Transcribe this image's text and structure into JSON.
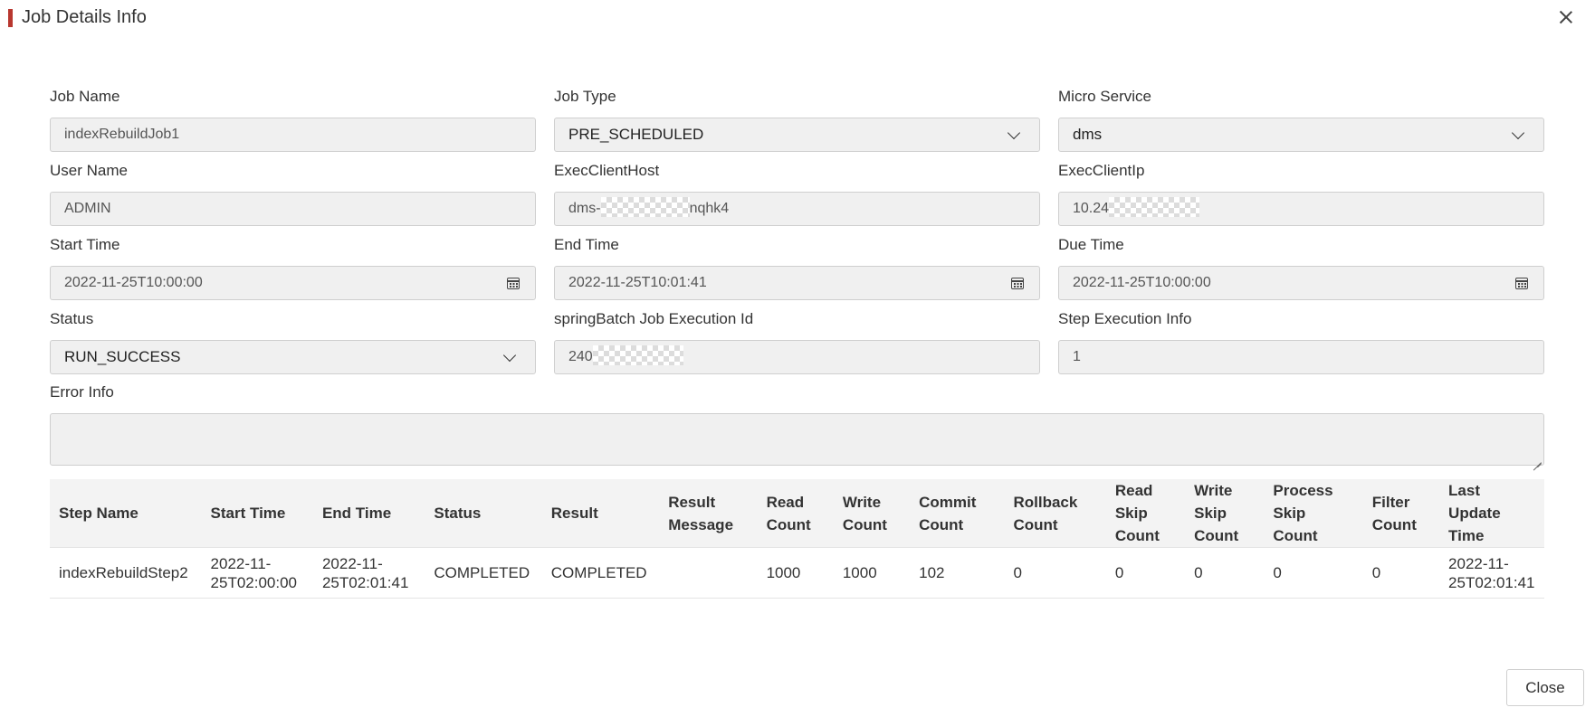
{
  "dialog": {
    "title": "Job Details Info",
    "close_label": "Close"
  },
  "form": {
    "job_name": {
      "label": "Job Name",
      "value": "indexRebuildJob1"
    },
    "job_type": {
      "label": "Job Type",
      "value": "PRE_SCHEDULED"
    },
    "micro_service": {
      "label": "Micro Service",
      "value": "dms"
    },
    "user_name": {
      "label": "User Name",
      "value": "ADMIN"
    },
    "exec_client_host": {
      "label": "ExecClientHost",
      "value_prefix": "dms-",
      "value_suffix": "nqhk4"
    },
    "exec_client_ip": {
      "label": "ExecClientIp",
      "value_prefix": "10.24"
    },
    "start_time": {
      "label": "Start Time",
      "value": "2022-11-25T10:00:00"
    },
    "end_time": {
      "label": "End Time",
      "value": "2022-11-25T10:01:41"
    },
    "due_time": {
      "label": "Due Time",
      "value": "2022-11-25T10:00:00"
    },
    "status": {
      "label": "Status",
      "value": "RUN_SUCCESS"
    },
    "spring_batch_id": {
      "label": "springBatch Job Execution Id",
      "value_prefix": "240"
    },
    "step_execution_info": {
      "label": "Step Execution Info",
      "value": "1"
    },
    "error_info": {
      "label": "Error Info",
      "value": ""
    }
  },
  "table": {
    "headers": [
      "Step Name",
      "Start Time",
      "End Time",
      "Status",
      "Result",
      "Result Message",
      "Read Count",
      "Write Count",
      "Commit Count",
      "Rollback Count",
      "Read Skip Count",
      "Write Skip Count",
      "Process Skip Count",
      "Filter Count",
      "Last Update Time"
    ],
    "rows": [
      [
        "indexRebuildStep2",
        "2022-11-25T02:00:00",
        "2022-11-25T02:01:41",
        "COMPLETED",
        "COMPLETED",
        "",
        "1000",
        "1000",
        "102",
        "0",
        "0",
        "0",
        "0",
        "0",
        "2022-11-25T02:01:41"
      ]
    ]
  }
}
